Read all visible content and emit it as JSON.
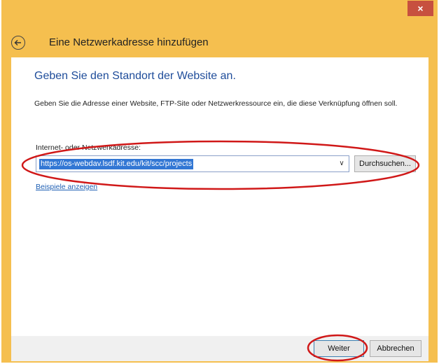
{
  "window": {
    "close_glyph": "×"
  },
  "header": {
    "title": "Eine Netzwerkadresse hinzufügen",
    "back_icon": "back-arrow-icon"
  },
  "content": {
    "heading": "Geben Sie den Standort der Website an.",
    "description": "Geben Sie die Adresse einer Website, FTP-Site oder Netzwerkressource ein, die diese Verknüpfung öffnen soll.",
    "field_label": "Internet- oder Netzwerkadresse:",
    "address_value": "https://os-webdav.lsdf.kit.edu/kit/scc/projects",
    "browse_label": "Durchsuchen...",
    "examples_link": "Beispiele anzeigen"
  },
  "footer": {
    "next_label": "Weiter",
    "cancel_label": "Abbrechen"
  },
  "colors": {
    "accent": "#f5bf4f",
    "heading": "#1e4c9a",
    "selection": "#3277d4",
    "annotation": "#d01818"
  }
}
